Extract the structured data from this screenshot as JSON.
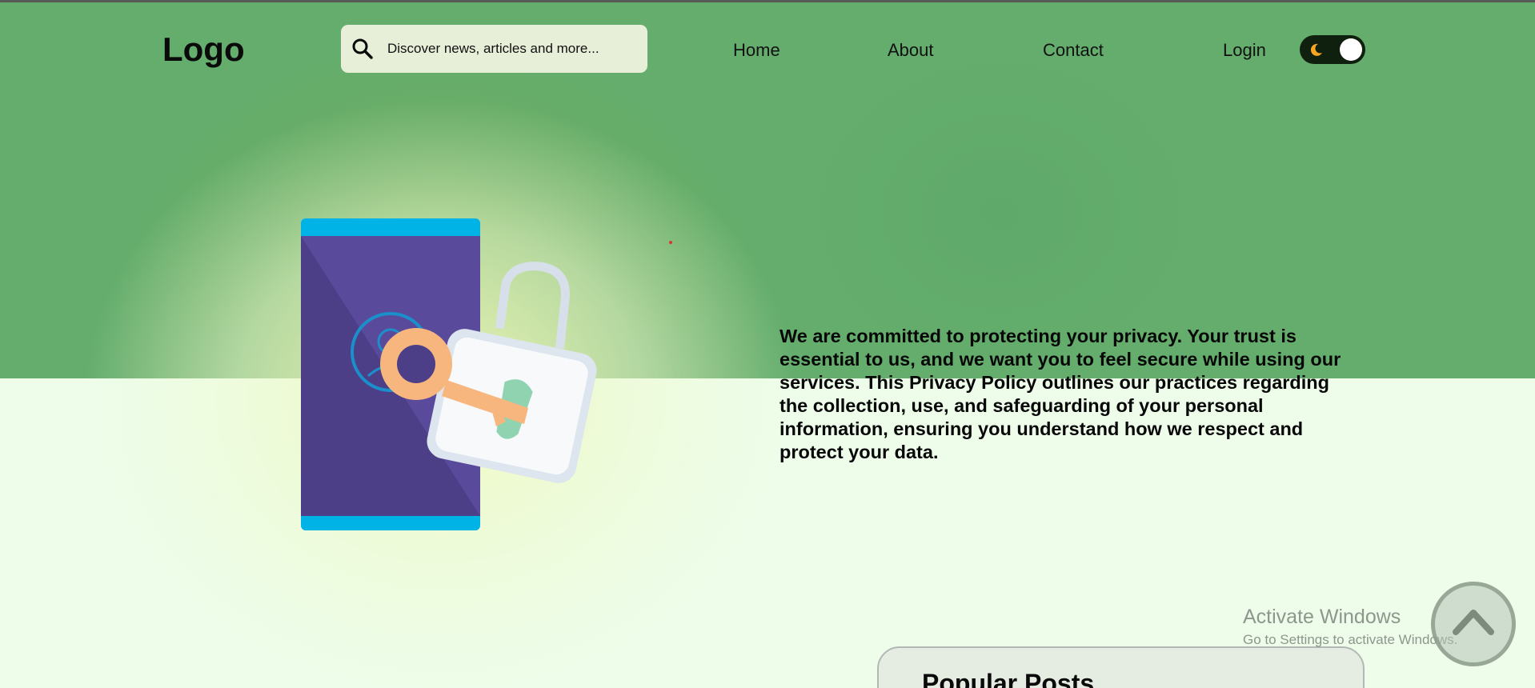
{
  "header": {
    "logo_text": "Logo",
    "search": {
      "placeholder": "Discover news, articles and more..."
    },
    "nav": {
      "home": "Home",
      "about": "About",
      "contact": "Contact",
      "login": "Login"
    },
    "theme_toggle": {
      "state": "dark",
      "icon": "moon-icon"
    }
  },
  "hero": {
    "illustration": "phone-lock-key-illustration",
    "intro_text": "We are committed to protecting your privacy. Your trust is essential to us, and we want you to feel secure while using our services. This Privacy Policy outlines our practices regarding the collection, use, and safeguarding of your personal information, ensuring you understand how we respect and protect your data."
  },
  "sidebar": {
    "popular_posts_title": "Popular Posts"
  },
  "os_watermark": {
    "title": "Activate Windows",
    "subtitle": "Go to Settings to activate Windows."
  },
  "colors": {
    "header_band": "#64ad6c",
    "page_background": "#edfdea",
    "search_background": "#e7efd9",
    "toggle_background": "#10200f",
    "moon": "#f5a623",
    "phone_body": "#5a4a9c",
    "phone_accent": "#00b3e6",
    "key": "#f8b67f",
    "keyhole": "#8fd3b0"
  }
}
